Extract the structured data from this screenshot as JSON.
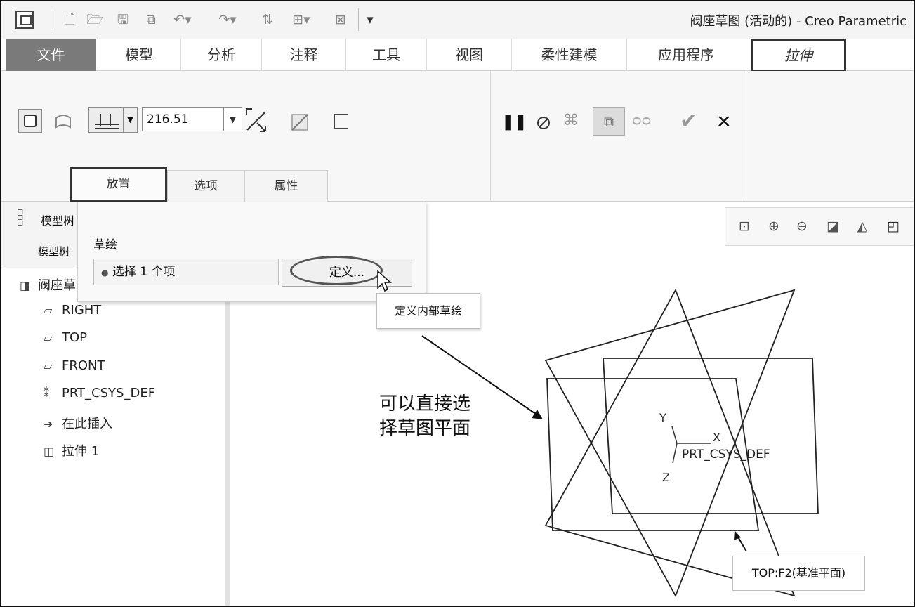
{
  "window_title": "阀座草图 (活动的) - Creo Parametric",
  "ribbon_tabs": [
    "文件",
    "模型",
    "分析",
    "注释",
    "工具",
    "视图",
    "柔性建模",
    "应用程序",
    "拉伸"
  ],
  "extrude": {
    "depth_value": "216.51"
  },
  "dashboard_tabs": [
    "放置",
    "选项",
    "属性"
  ],
  "model_tree": {
    "header_title": "模型树",
    "header_sub": "模型树",
    "root": "阀座草图",
    "items": [
      {
        "icon": "datum-plane-icon",
        "label": "RIGHT"
      },
      {
        "icon": "datum-plane-icon",
        "label": "TOP"
      },
      {
        "icon": "datum-plane-icon",
        "label": "FRONT"
      },
      {
        "icon": "csys-icon",
        "label": "PRT_CSYS_DEF"
      },
      {
        "icon": "insert-here-icon",
        "label": "在此插入"
      },
      {
        "icon": "extrude-feature-icon",
        "label": "拉伸 1"
      }
    ]
  },
  "placement_panel": {
    "section_label": "草绘",
    "collector_text": "选择 1 个项",
    "define_button": "定义..."
  },
  "tooltip": "定义内部草绘",
  "annotation": {
    "line1": "可以直接选",
    "line2": "择草图平面"
  },
  "graphics": {
    "axis_y": "Y",
    "axis_x": "X",
    "axis_z": "Z",
    "csys_label": "PRT_CSYS_DEF",
    "plane_label": "TOP:F2(基准平面)"
  },
  "accent_colors": {
    "file_tab": "#7a7a7a",
    "confirm_check": "#9a9a9a",
    "cancel_x": "#111111"
  }
}
